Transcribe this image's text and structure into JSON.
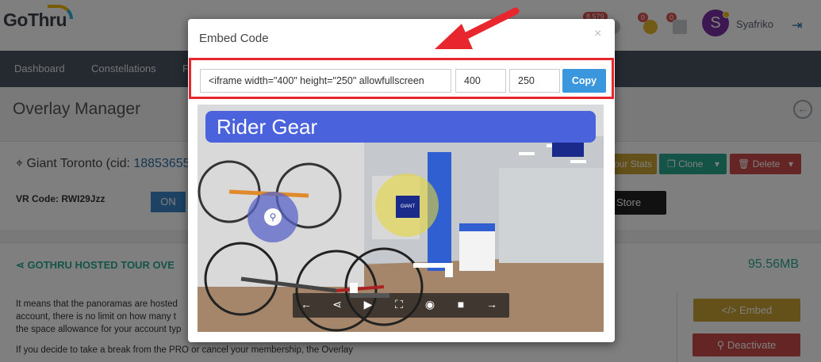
{
  "app": {
    "logo_text": "GoThru",
    "notification_badges": [
      "8,579",
      "0",
      "0"
    ],
    "avatar_letter": "S",
    "username": "Syafriko"
  },
  "nav": {
    "items": [
      "Dashboard",
      "Constellations",
      "F"
    ]
  },
  "page": {
    "title": "Overlay Manager",
    "location_name": "Giant Toronto (cid: ",
    "location_cid": "18853655",
    "vr_code_label": "VR Code: RWI29Jzz",
    "on_label": "ON",
    "stats_label": "our Stats",
    "clone_label": "Clone",
    "delete_label": "Delete",
    "store_label": "Store",
    "hosted_title": "GOTHRU HOSTED TOUR OVE",
    "hosted_size": "95.56MB",
    "body_lines": [
      "It means that the panoramas are hosted",
      "account, there is no limit on how many t",
      "the space allowance for your account typ",
      "If you decide to take a break from the PRO or cancel your membership, the Overlay"
    ],
    "embed_label": "</> Embed",
    "deactivate_label": "Deactivate"
  },
  "modal": {
    "title": "Embed Code",
    "close_glyph": "×",
    "code_value": "<iframe width=\"400\" height=\"250\" allowfullscreen",
    "width_value": "400",
    "height_value": "250",
    "copy_label": "Copy",
    "preview_title": "Rider Gear"
  },
  "colors": {
    "accent_blue": "#3a96dd",
    "highlight_red": "#e8262e",
    "teal": "#28a98f",
    "gold": "#c9a234",
    "danger": "#cc4b4b"
  },
  "icons": {
    "bike_hotspot": "bicycle-icon",
    "controls": [
      "arrow-left-icon",
      "share-icon",
      "play-icon",
      "fullscreen-icon",
      "eye-icon",
      "camera-icon",
      "arrow-right-icon"
    ]
  }
}
